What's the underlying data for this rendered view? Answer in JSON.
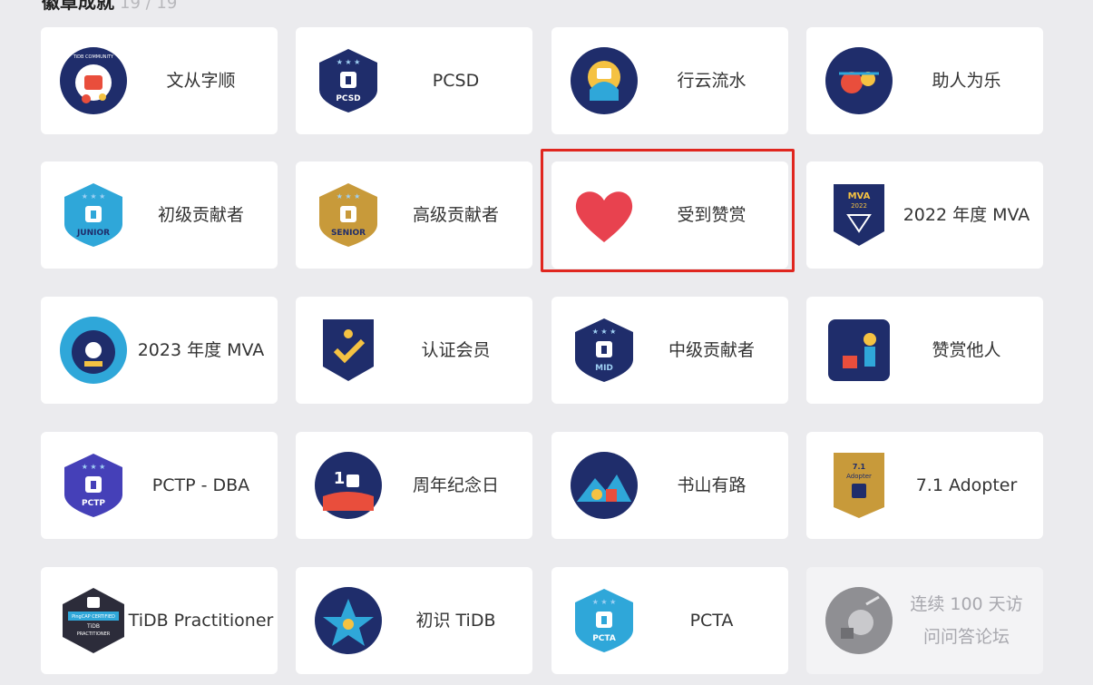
{
  "section": {
    "title": "徽章成就",
    "count": "19 / 19"
  },
  "badges": [
    {
      "name": "文从字顺",
      "icon": "wencongzishun-badge-icon",
      "enabled": true
    },
    {
      "name": "PCSD",
      "icon": "pcsd-badge-icon",
      "enabled": true
    },
    {
      "name": "行云流水",
      "icon": "xingyunliushui-badge-icon",
      "enabled": true
    },
    {
      "name": "助人为乐",
      "icon": "zhurenweile-badge-icon",
      "enabled": true
    },
    {
      "name": "初级贡献者",
      "icon": "junior-contributor-badge-icon",
      "enabled": true
    },
    {
      "name": "高级贡献者",
      "icon": "senior-contributor-badge-icon",
      "enabled": true
    },
    {
      "name": "受到赞赏",
      "icon": "heart-icon",
      "enabled": true
    },
    {
      "name": "2022 年度 MVA",
      "icon": "mva-2022-badge-icon",
      "enabled": true
    },
    {
      "name": "2023 年度 MVA",
      "icon": "mva-2023-badge-icon",
      "enabled": true
    },
    {
      "name": "认证会员",
      "icon": "verified-member-badge-icon",
      "enabled": true
    },
    {
      "name": "中级贡献者",
      "icon": "mid-contributor-badge-icon",
      "enabled": true
    },
    {
      "name": "赞赏他人",
      "icon": "appreciate-others-badge-icon",
      "enabled": true
    },
    {
      "name": "PCTP - DBA",
      "icon": "pctp-badge-icon",
      "enabled": true
    },
    {
      "name": "周年纪念日",
      "icon": "anniversary-badge-icon",
      "enabled": true
    },
    {
      "name": "书山有路",
      "icon": "shushanyoulu-badge-icon",
      "enabled": true
    },
    {
      "name": "7.1 Adopter",
      "icon": "adopter-7-1-badge-icon",
      "enabled": true
    },
    {
      "name": "TiDB Practitioner",
      "icon": "tidb-practitioner-badge-icon",
      "enabled": true
    },
    {
      "name": "初识 TiDB",
      "icon": "chushi-tidb-badge-icon",
      "enabled": true
    },
    {
      "name": "PCTA",
      "icon": "pcta-badge-icon",
      "enabled": true
    },
    {
      "name": "连续 100 天访问问答论坛",
      "icon": "visit-100-days-badge-icon",
      "enabled": false
    }
  ],
  "badge_texts": {
    "pcsd": "PCSD",
    "junior": "JUNIOR",
    "senior": "SENIOR",
    "mid": "MID",
    "pctp": "PCTP",
    "pcta": "PCTA",
    "mva": "MVA",
    "mva_year": "2022",
    "adopter_ver": "7.1",
    "adopter": "Adopter",
    "anniv": "1",
    "practitioner_org": "PingCAP CERTIFIED",
    "practitioner_l1": "TiDB",
    "practitioner_l2": "PRACTITIONER",
    "community": "TiDB COMMUNITY"
  },
  "colors": {
    "navy": "#1f2d6b",
    "cyan": "#2fa7d9",
    "gold": "#c89a3a",
    "purple": "#4540b8",
    "heart": "#e8424f",
    "highlight": "#e0261f"
  }
}
